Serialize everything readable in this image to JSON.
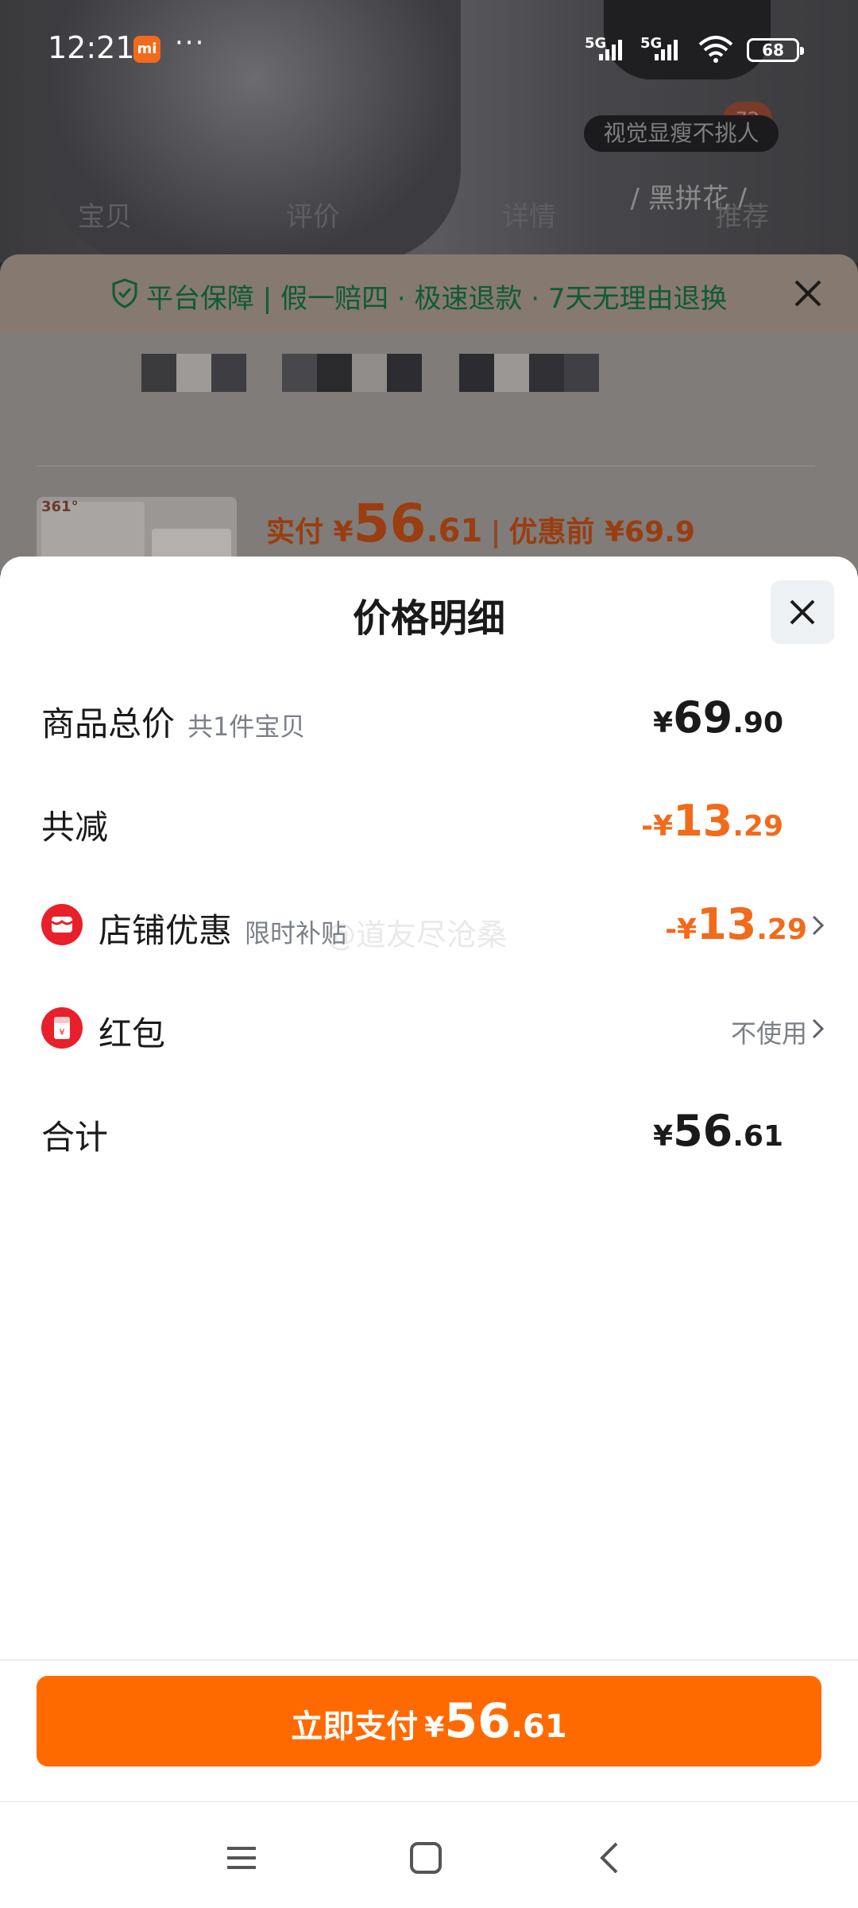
{
  "status_bar": {
    "time": "12:21",
    "app_icon": "mi-icon",
    "more": "···",
    "network_1": "5G",
    "network_2": "5G",
    "battery": "68"
  },
  "background": {
    "badge_count": "72",
    "tag": "视觉显瘦不挑人",
    "variant": "/ 黑拼花 /",
    "tabs": [
      "宝贝",
      "评价",
      "详情",
      "推荐"
    ],
    "guarantee": "平台保障 | 假一赔四 · 极速退款 · 7天无理由退换",
    "thumb_brand": "361°",
    "pay_label": "实付 ¥",
    "pay_int": "56",
    "pay_dec": ".61",
    "original_label": "优惠前 ¥69.9"
  },
  "sheet": {
    "title": "价格明细",
    "rows": {
      "total": {
        "label": "商品总价",
        "sub": "共1件宝贝",
        "currency": "¥",
        "int": "69",
        "dec": ".90"
      },
      "reduction": {
        "label": "共减",
        "currency": "-¥",
        "int": "13",
        "dec": ".29"
      },
      "shop_discount": {
        "label": "店铺优惠",
        "sub": "限时补贴",
        "currency": "-¥",
        "int": "13",
        "dec": ".29",
        "icon": "shop-icon"
      },
      "red_packet": {
        "label": "红包",
        "value": "不使用",
        "icon": "red-packet-icon"
      },
      "sum": {
        "label": "合计",
        "currency": "¥",
        "int": "56",
        "dec": ".61"
      }
    },
    "watermark": "@道友尽沧桑"
  },
  "pay_button": {
    "label": "立即支付",
    "currency": "¥",
    "int": "56",
    "dec": ".61"
  },
  "colors": {
    "accent": "#ff6a00",
    "price_orange": "#f26a1b",
    "icon_red": "#e8202b"
  }
}
